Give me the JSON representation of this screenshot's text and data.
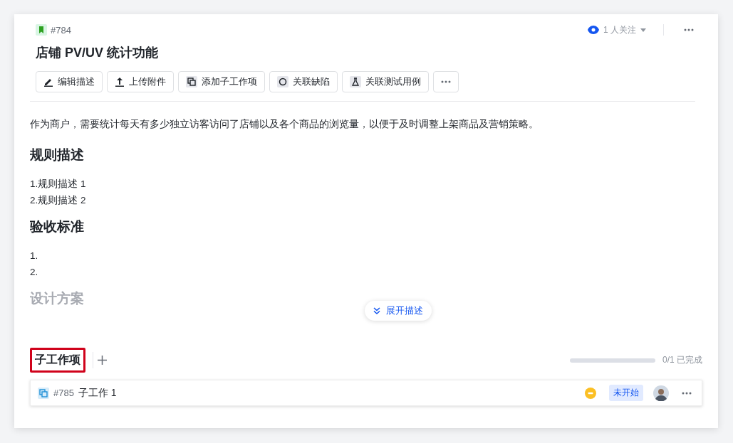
{
  "header": {
    "id": "#784",
    "title": "店铺 PV/UV 统计功能",
    "watchers": "1 人关注"
  },
  "toolbar": [
    {
      "kind": "edit",
      "label": "编辑描述"
    },
    {
      "kind": "upload",
      "label": "上传附件"
    },
    {
      "kind": "subtask",
      "label": "添加子工作项"
    },
    {
      "kind": "bug",
      "label": "关联缺陷"
    },
    {
      "kind": "test",
      "label": "关联测试用例"
    },
    {
      "kind": "more"
    }
  ],
  "description": {
    "intro": "作为商户，需要统计每天有多少独立访客访问了店铺以及各个商品的浏览量，以便于及时调整上架商品及营销策略。",
    "sections": [
      {
        "heading": "规则描述",
        "lines": [
          "1.规则描述 1",
          "2.规则描述 2"
        ]
      },
      {
        "heading": "验收标准",
        "lines": [
          "1.",
          "2."
        ]
      }
    ],
    "faded_heading": "设计方案",
    "expand_button": "展开描述"
  },
  "subtasks": {
    "tab": {
      "label": "子工作项",
      "highlighted": true
    },
    "progress": {
      "level": 0,
      "reading": "0/1 已完成"
    },
    "items": [
      {
        "id": "#785",
        "title": "子工作 1",
        "status": "未开始"
      }
    ]
  }
}
